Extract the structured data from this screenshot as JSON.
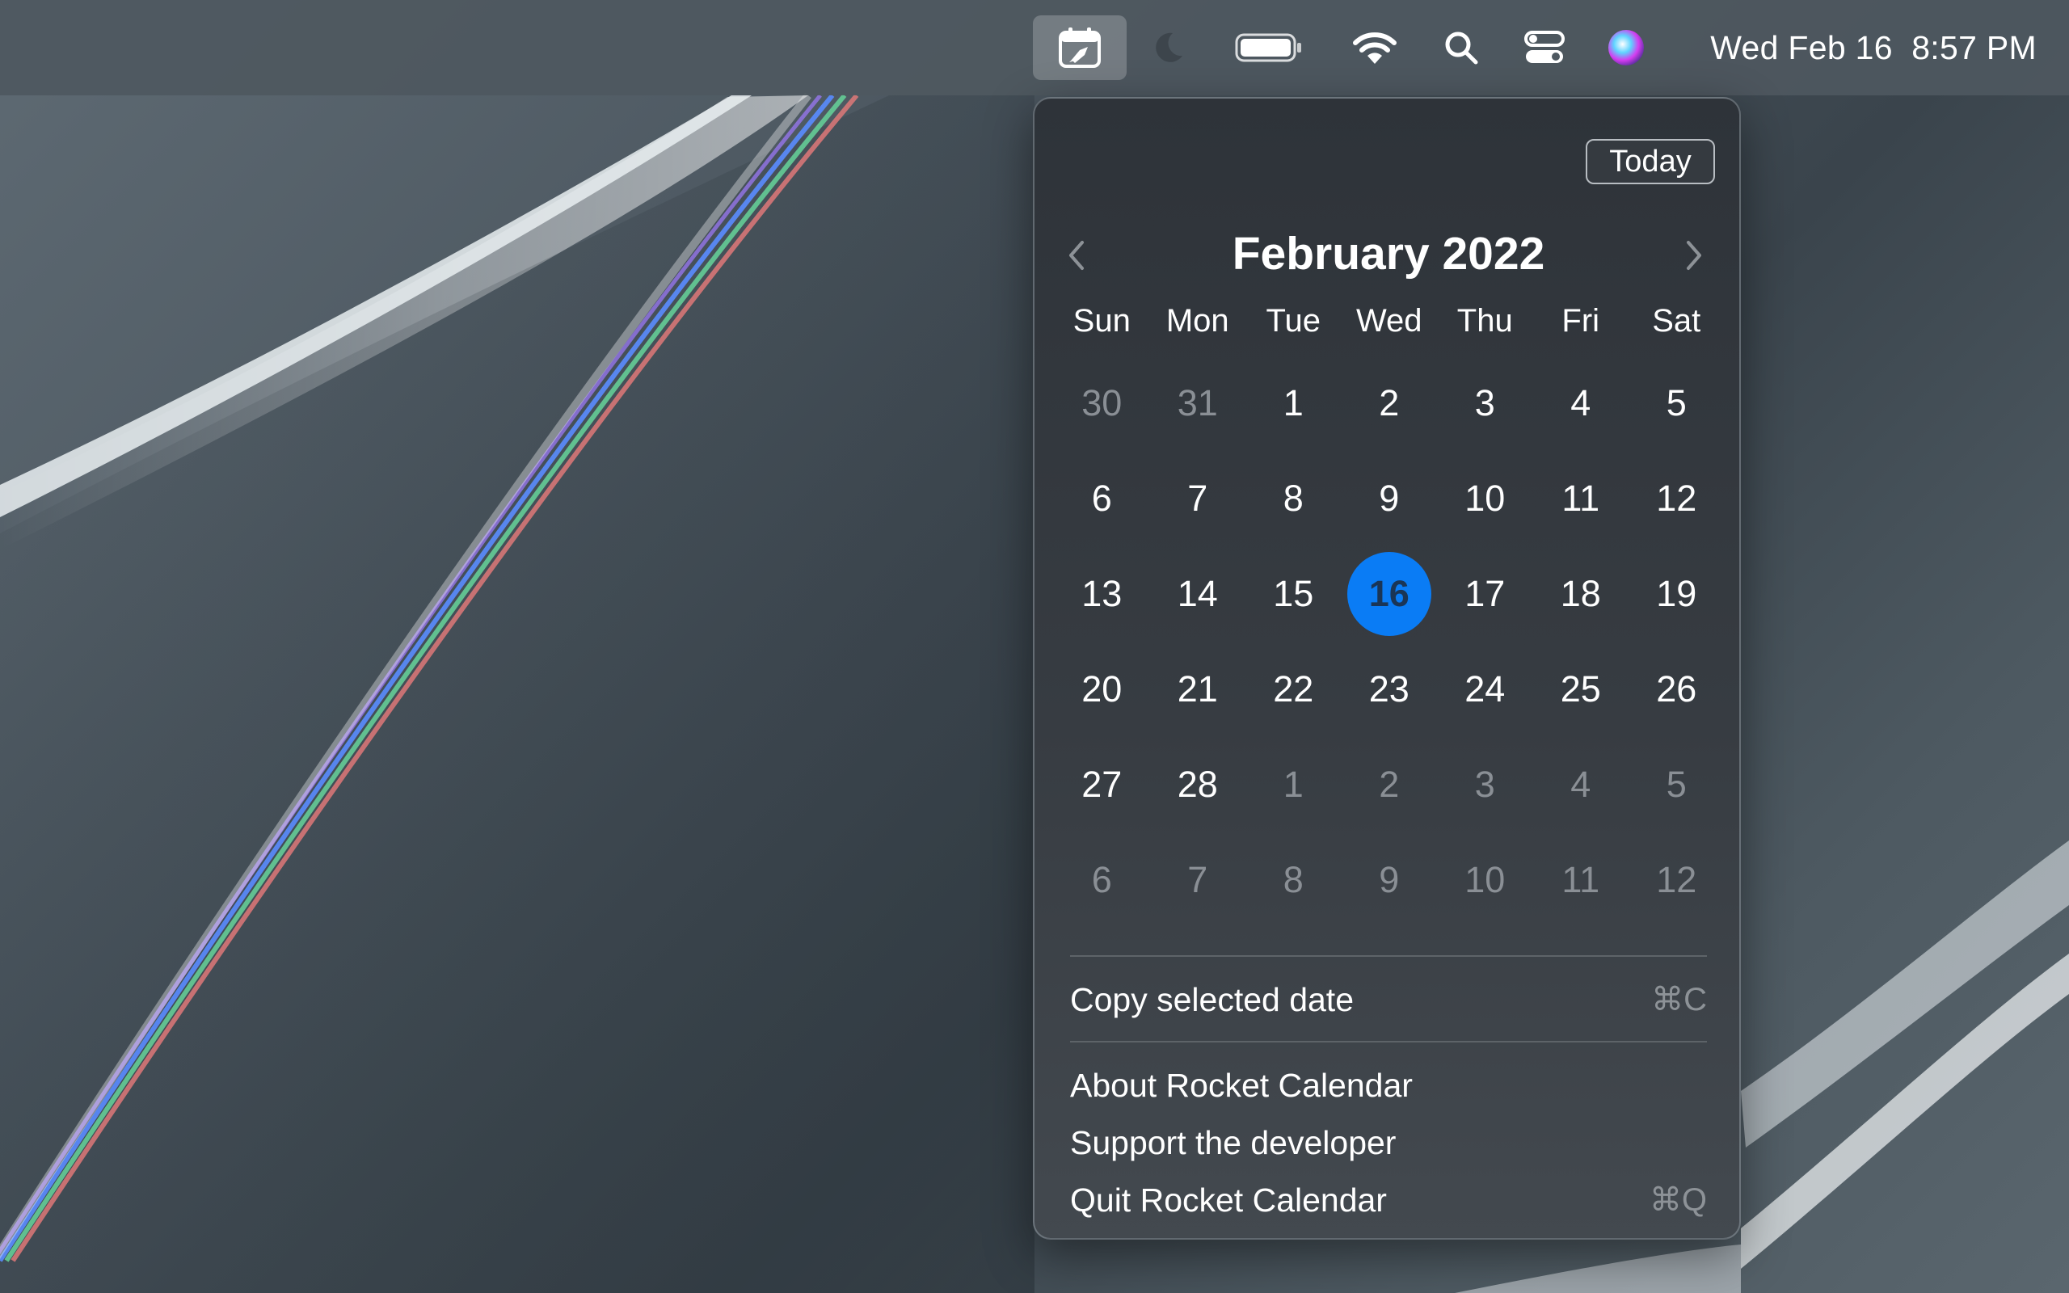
{
  "menubar": {
    "clock": "Wed Feb 16  8:57 PM",
    "icons": [
      "rocket-calendar-icon",
      "moon-icon",
      "battery-icon",
      "wifi-icon",
      "search-icon",
      "control-center-icon",
      "siri-icon"
    ]
  },
  "calendar": {
    "today_label": "Today",
    "month_title": "February 2022",
    "weekdays": [
      "Sun",
      "Mon",
      "Tue",
      "Wed",
      "Thu",
      "Fri",
      "Sat"
    ],
    "selected_day": "16",
    "accent_color": "#0a7cf5",
    "weeks": [
      [
        {
          "d": "30",
          "other": true
        },
        {
          "d": "31",
          "other": true
        },
        {
          "d": "1"
        },
        {
          "d": "2"
        },
        {
          "d": "3"
        },
        {
          "d": "4"
        },
        {
          "d": "5"
        }
      ],
      [
        {
          "d": "6"
        },
        {
          "d": "7"
        },
        {
          "d": "8"
        },
        {
          "d": "9"
        },
        {
          "d": "10"
        },
        {
          "d": "11"
        },
        {
          "d": "12"
        }
      ],
      [
        {
          "d": "13"
        },
        {
          "d": "14"
        },
        {
          "d": "15"
        },
        {
          "d": "16",
          "selected": true
        },
        {
          "d": "17"
        },
        {
          "d": "18"
        },
        {
          "d": "19"
        }
      ],
      [
        {
          "d": "20"
        },
        {
          "d": "21"
        },
        {
          "d": "22"
        },
        {
          "d": "23"
        },
        {
          "d": "24"
        },
        {
          "d": "25"
        },
        {
          "d": "26"
        }
      ],
      [
        {
          "d": "27"
        },
        {
          "d": "28"
        },
        {
          "d": "1",
          "other": true
        },
        {
          "d": "2",
          "other": true
        },
        {
          "d": "3",
          "other": true
        },
        {
          "d": "4",
          "other": true
        },
        {
          "d": "5",
          "other": true
        }
      ],
      [
        {
          "d": "6",
          "other": true
        },
        {
          "d": "7",
          "other": true
        },
        {
          "d": "8",
          "other": true
        },
        {
          "d": "9",
          "other": true
        },
        {
          "d": "10",
          "other": true
        },
        {
          "d": "11",
          "other": true
        },
        {
          "d": "12",
          "other": true
        }
      ]
    ]
  },
  "menu": {
    "copy_label": "Copy selected date",
    "copy_shortcut": "⌘C",
    "about_label": "About Rocket Calendar",
    "support_label": "Support the developer",
    "quit_label": "Quit Rocket Calendar",
    "quit_shortcut": "⌘Q"
  }
}
